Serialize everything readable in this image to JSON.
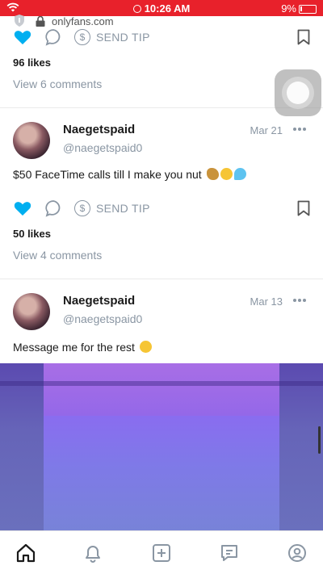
{
  "status_bar": {
    "time": "10:26 AM",
    "battery": "9%",
    "accent": "#e8212b"
  },
  "browser": {
    "url": "onlyfans.com"
  },
  "colors": {
    "like_active": "#00aff0",
    "muted": "#8a96a3"
  },
  "posts": [
    {
      "send_tip_label": "SEND TIP",
      "liked": true,
      "likes_text": "96 likes",
      "comments_text": "View 6 comments"
    },
    {
      "name": "Naegetspaid",
      "handle": "@naegetspaid0",
      "date": "Mar 21",
      "text": "$50 FaceTime calls till I make you nut",
      "emojis": [
        "peanut-emoji",
        "tongue-face-emoji",
        "sweat-droplets-emoji"
      ],
      "send_tip_label": "SEND TIP",
      "liked": true,
      "likes_text": "50 likes",
      "comments_text": "View 4 comments"
    },
    {
      "name": "Naegetspaid",
      "handle": "@naegetspaid0",
      "date": "Mar 13",
      "text": "Message me for the rest",
      "emojis": [
        "tongue-face-emoji"
      ]
    }
  ],
  "tab_bar": {
    "items": [
      "home-icon",
      "bell-icon",
      "add-post-icon",
      "messages-icon",
      "profile-icon"
    ],
    "active": "home-icon"
  }
}
